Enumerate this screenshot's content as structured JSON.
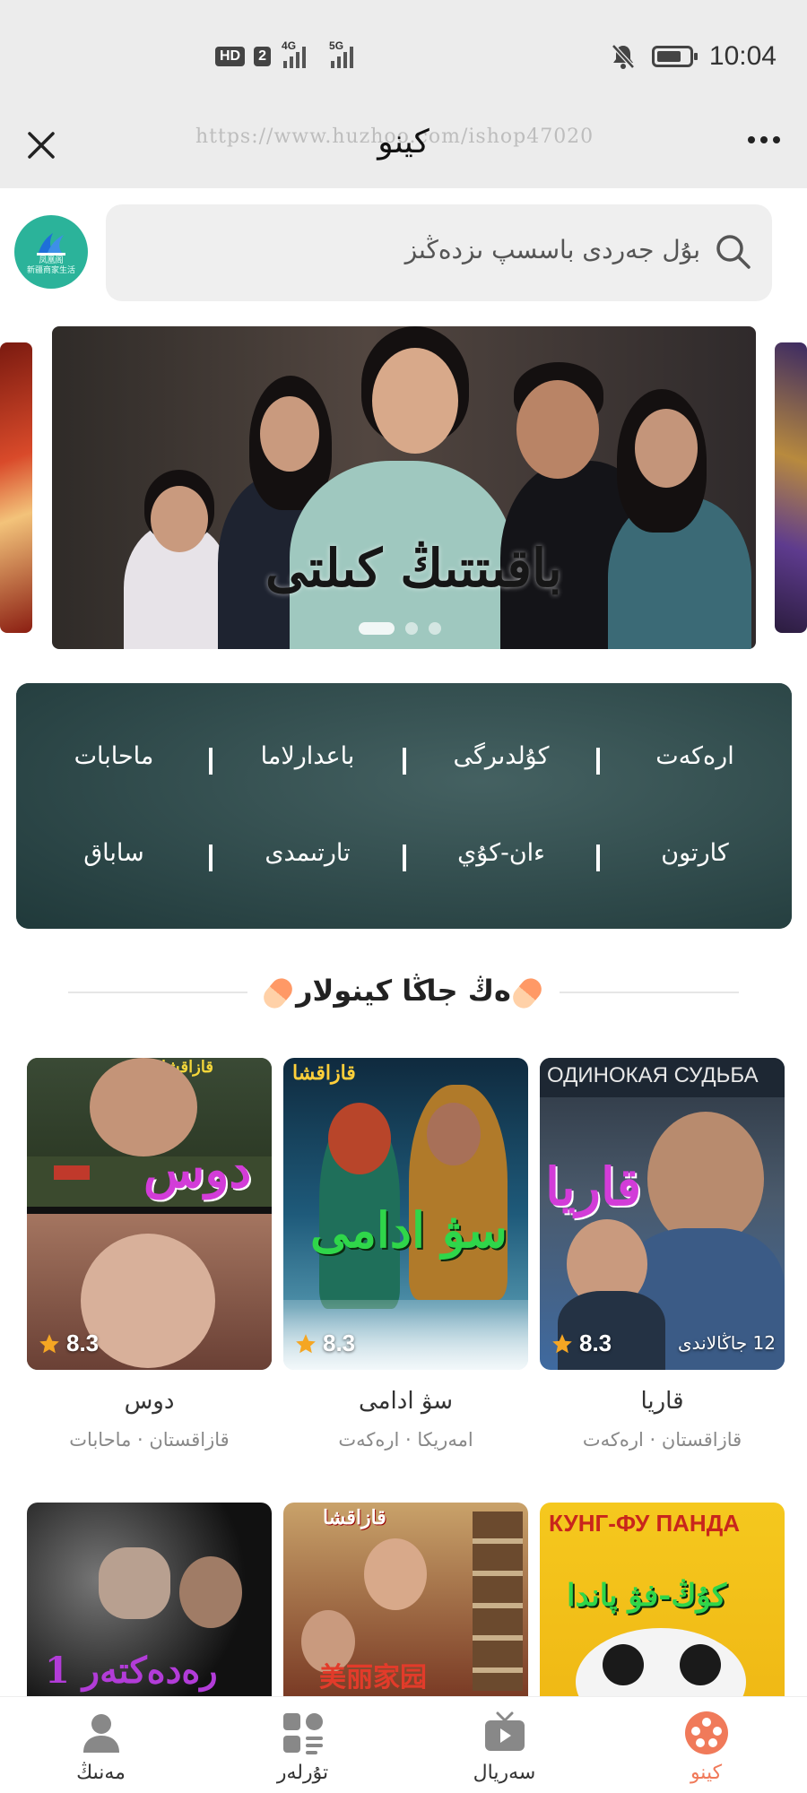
{
  "status_bar": {
    "time": "10:04",
    "hd_label": "HD",
    "sim_label": "2",
    "net1": "4G",
    "net2": "5G"
  },
  "title_bar": {
    "title": "كينو",
    "url_watermark": "https://www.huzhoo.com/ishop47020",
    "close_icon": "close-icon",
    "more_icon": "more-icon"
  },
  "logo": {
    "line1": "凤凰阁",
    "line2": "新疆商家生活"
  },
  "search": {
    "placeholder": "بۇل جەردى باسسپ ىزدەڭىز",
    "icon": "search-icon"
  },
  "banner": {
    "title": "باقىتتىڭ كىلتى",
    "slides": 3,
    "active_slide": 1
  },
  "categories": {
    "row1": [
      "ارەكەت",
      "كۇلدىرگى",
      "باعدارلاما",
      "ماحابات"
    ],
    "row2": [
      "كارتون",
      "ءان-كۇي",
      "تارتىمدى",
      "ساباق"
    ]
  },
  "section": {
    "title": "ەڭ جاڭا كينولار"
  },
  "movies": [
    {
      "title": "قاريا",
      "meta": "قازاقستان · ارەكەت",
      "rating": "8.3",
      "episodes": "12 جاڭالاندى",
      "poster_text": "قاريا",
      "poster_top": "ОДИНОКАЯ СУДЬБА"
    },
    {
      "title": "سۋ ادامى",
      "meta": "امەريكا · ارەكەت",
      "rating": "8.3",
      "poster_text": "سۋ ادامى",
      "poster_top": "قازاقشا"
    },
    {
      "title": "دوس",
      "meta": "قازاقستان · ماحابات",
      "rating": "8.3",
      "poster_text": "دوس",
      "poster_top": "قازاقشا"
    },
    {
      "poster_text": "كۇڭ-فۋ پاندا",
      "poster_top": "КУНГ-ФУ ПАНДА"
    },
    {
      "poster_text": "美丽家园",
      "poster_top": "قازاقشا"
    },
    {
      "poster_text": "رەدەكتەر 1"
    }
  ],
  "bottom_nav": [
    {
      "label": "كينو",
      "icon": "film-reel-icon",
      "active": true
    },
    {
      "label": "سەريال",
      "icon": "tv-icon",
      "active": false
    },
    {
      "label": "تۇرلەر",
      "icon": "category-grid-icon",
      "active": false
    },
    {
      "label": "مەنىڭ",
      "icon": "user-icon",
      "active": false
    }
  ],
  "colors": {
    "accent": "#f07a5a",
    "category_panel": "#2f4a4b",
    "logo": "#2bb39a",
    "rating_star": "#f5a623"
  }
}
